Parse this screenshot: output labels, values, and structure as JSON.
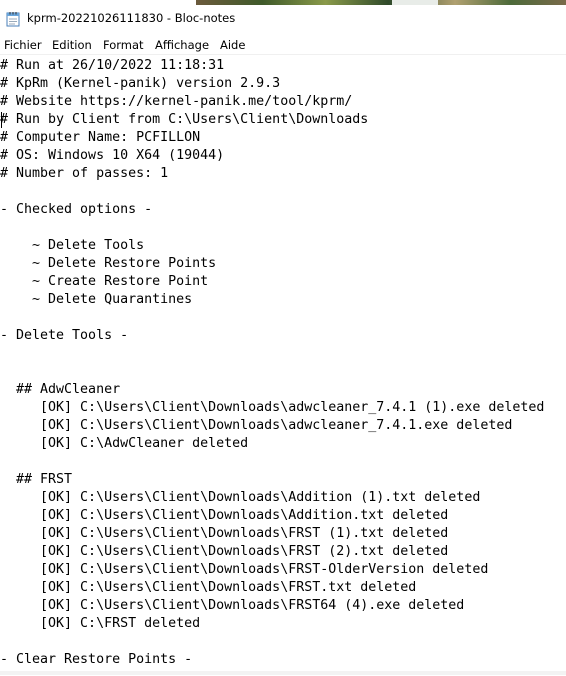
{
  "window": {
    "title": "kprm-20221026111830 - Bloc-notes",
    "icon": "notepad-icon"
  },
  "menu": {
    "items": [
      "Fichier",
      "Edition",
      "Format",
      "Affichage",
      "Aide"
    ]
  },
  "document": {
    "lines": [
      "# Run at 26/10/2022 11:18:31",
      "# KpRm (Kernel-panik) version 2.9.3",
      "# Website https://kernel-panik.me/tool/kprm/",
      "# Run by Client from C:\\Users\\Client\\Downloads",
      "# Computer Name: PCFILLON",
      "# OS: Windows 10 X64 (19044)",
      "# Number of passes: 1",
      "",
      "- Checked options -",
      "",
      "    ~ Delete Tools",
      "    ~ Delete Restore Points",
      "    ~ Create Restore Point",
      "    ~ Delete Quarantines",
      "",
      "- Delete Tools -",
      "",
      "",
      "  ## AdwCleaner",
      "     [OK] C:\\Users\\Client\\Downloads\\adwcleaner_7.4.1 (1).exe deleted",
      "     [OK] C:\\Users\\Client\\Downloads\\adwcleaner_7.4.1.exe deleted",
      "     [OK] C:\\AdwCleaner deleted",
      "",
      "  ## FRST",
      "     [OK] C:\\Users\\Client\\Downloads\\Addition (1).txt deleted",
      "     [OK] C:\\Users\\Client\\Downloads\\Addition.txt deleted",
      "     [OK] C:\\Users\\Client\\Downloads\\FRST (1).txt deleted",
      "     [OK] C:\\Users\\Client\\Downloads\\FRST (2).txt deleted",
      "     [OK] C:\\Users\\Client\\Downloads\\FRST-OlderVersion deleted",
      "     [OK] C:\\Users\\Client\\Downloads\\FRST.txt deleted",
      "     [OK] C:\\Users\\Client\\Downloads\\FRST64 (4).exe deleted",
      "     [OK] C:\\FRST deleted",
      "",
      "- Clear Restore Points -"
    ]
  }
}
